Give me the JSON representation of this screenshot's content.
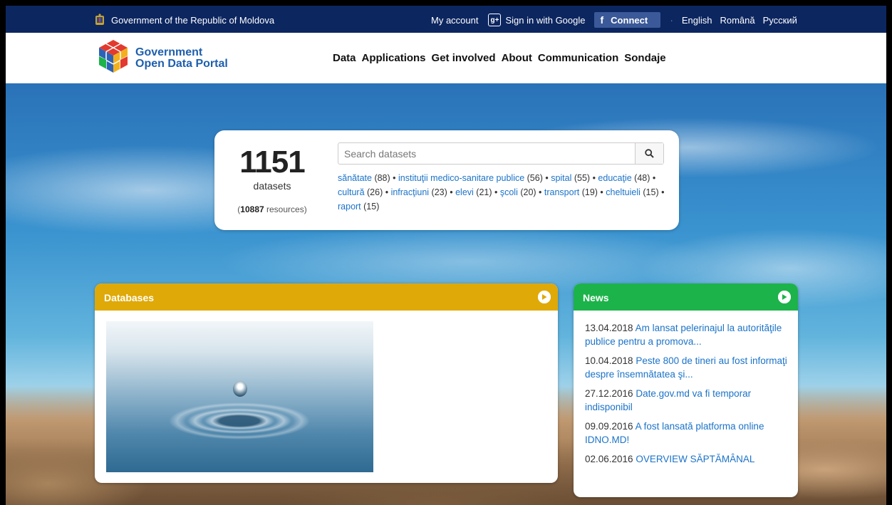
{
  "topbar": {
    "government": "Government of the Republic of Moldova",
    "my_account": "My account",
    "google_icon_text": "g+",
    "google_signin": "Sign in with Google",
    "facebook_glyph": "f",
    "facebook_connect": "Connect",
    "separator": "·",
    "languages": [
      "English",
      "Română",
      "Русский"
    ]
  },
  "brand": {
    "line1": "Government",
    "line2": "Open Data Portal"
  },
  "nav": [
    "Data",
    "Applications",
    "Get involved",
    "About",
    "Communication",
    "Sondaje"
  ],
  "stats": {
    "count": "1151",
    "count_label": "datasets",
    "resources_open": "(",
    "resources_number": "10887",
    "resources_label": " resources)"
  },
  "search": {
    "placeholder": "Search datasets",
    "value": ""
  },
  "tags": [
    {
      "name": "sănătate",
      "count": " (88)"
    },
    {
      "name": "instituţii medico-sanitare publice",
      "count": " (56)"
    },
    {
      "name": "spital",
      "count": " (55)"
    },
    {
      "name": "educaţie",
      "count": " (48)"
    },
    {
      "name": "cultură",
      "count": " (26)"
    },
    {
      "name": "infracţiuni",
      "count": " (23)"
    },
    {
      "name": "elevi",
      "count": " (21)"
    },
    {
      "name": "şcoli",
      "count": " (20)"
    },
    {
      "name": "transport",
      "count": " (19)"
    },
    {
      "name": "cheltuieli",
      "count": " (15)"
    },
    {
      "name": "raport",
      "count": " (15)"
    }
  ],
  "tag_separator": " • ",
  "databases": {
    "title": "Databases"
  },
  "news": {
    "title": "News",
    "items": [
      {
        "date": "13.04.2018",
        "text": "Am lansat pelerinajul la autorităţile publice pentru a promova..."
      },
      {
        "date": "10.04.2018",
        "text": "Peste 800 de tineri au fost informaţi despre însemnătatea şi..."
      },
      {
        "date": "27.12.2016",
        "text": "Date.gov.md va fi temporar indisponibil"
      },
      {
        "date": "09.09.2016",
        "text": "A fost lansată platforma online IDNO.MD!"
      },
      {
        "date": "02.06.2016",
        "text": "OVERVIEW SĂPTĂMÂNAL"
      }
    ]
  },
  "colors": {
    "topbar": "#0c2660",
    "link": "#1b73c8",
    "databases_header": "#dfa908",
    "news_header": "#1cb34a",
    "facebook": "#3b5998"
  },
  "icons": {
    "coat": "coat-of-arms-icon",
    "google": "google-plus-icon",
    "facebook": "facebook-icon",
    "logo": "open-data-cube-logo",
    "search": "search-icon",
    "arrow": "arrow-right-circle-icon"
  }
}
